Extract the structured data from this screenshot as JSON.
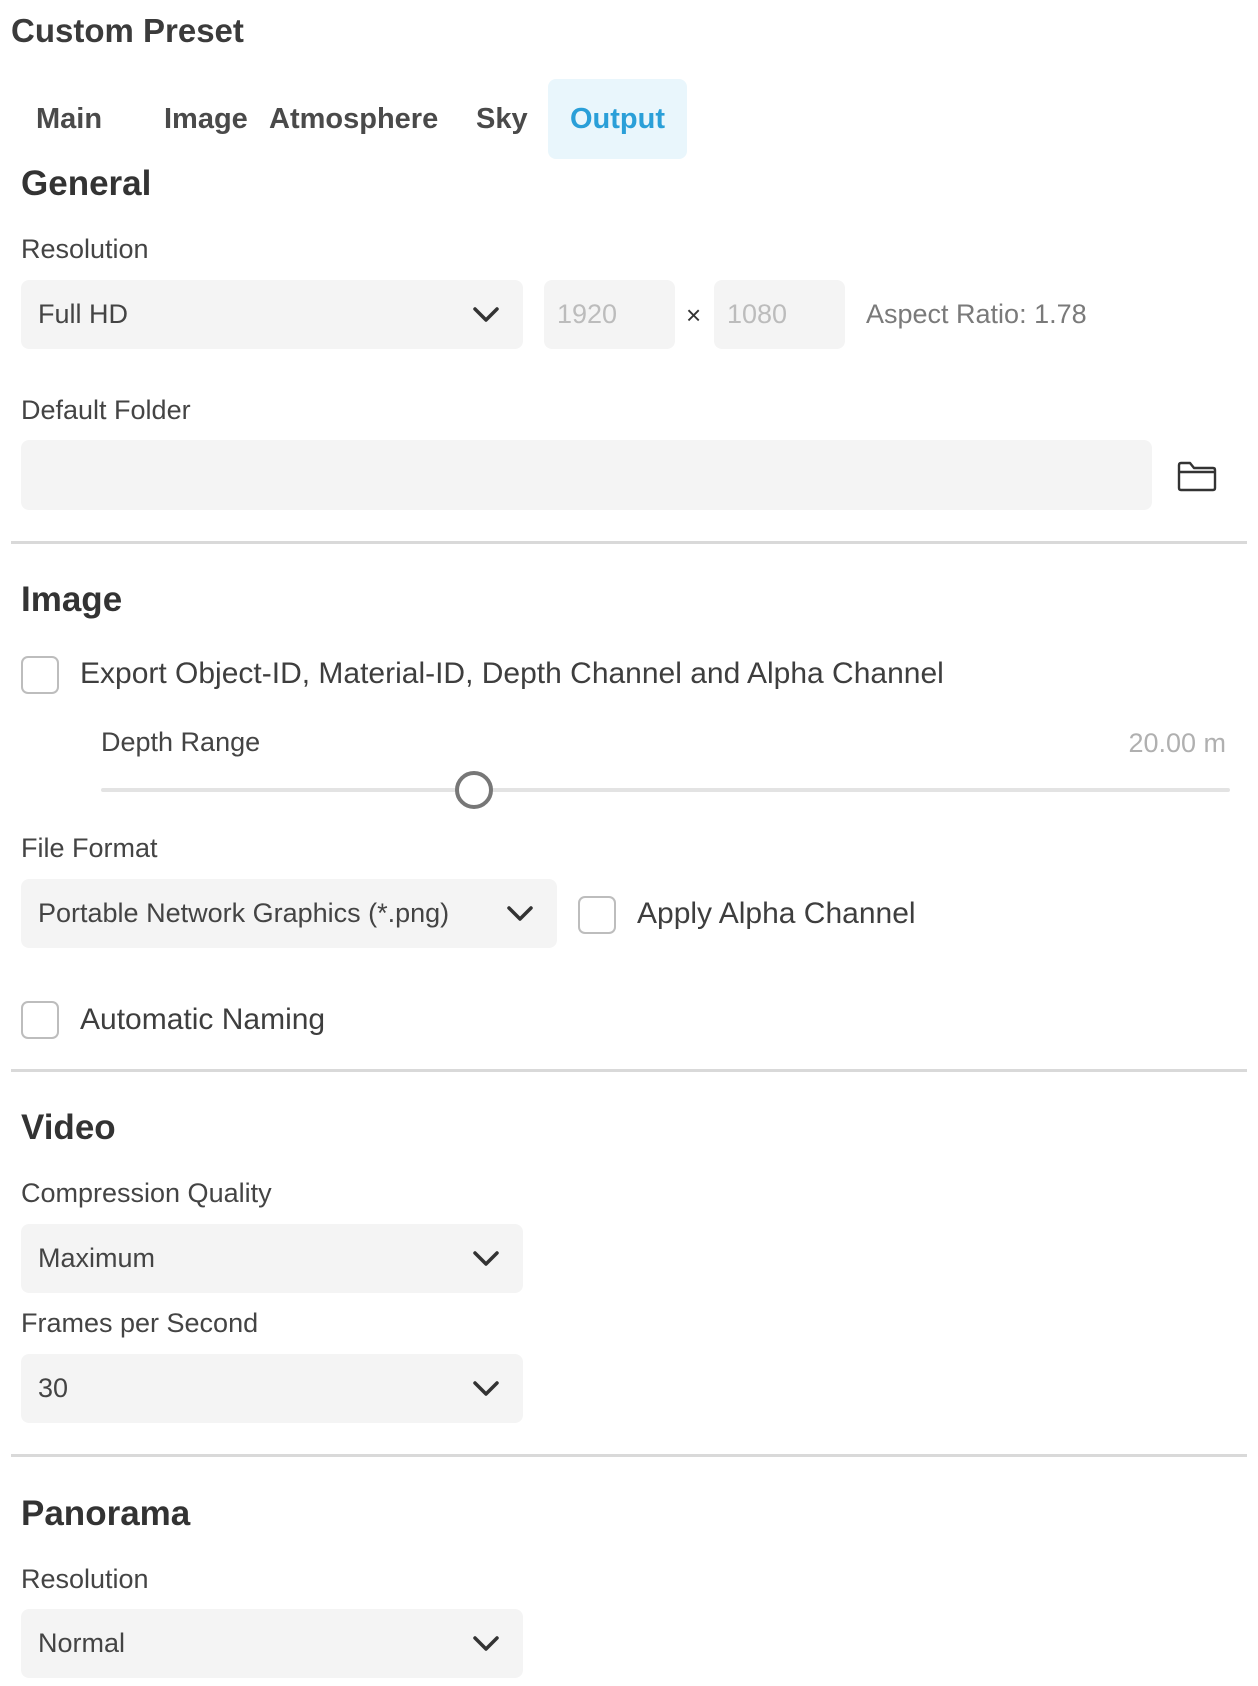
{
  "title": "Custom Preset",
  "tabs": [
    {
      "label": "Main"
    },
    {
      "label": "Image"
    },
    {
      "label": "Atmosphere"
    },
    {
      "label": "Sky"
    },
    {
      "label": "Output",
      "active": true
    }
  ],
  "general": {
    "heading": "General",
    "resolution_label": "Resolution",
    "resolution_value": "Full HD",
    "width": "1920",
    "times": "×",
    "height": "1080",
    "aspect_ratio": "Aspect Ratio: 1.78",
    "default_folder_label": "Default Folder",
    "default_folder_value": ""
  },
  "image": {
    "heading": "Image",
    "export_label": "Export Object-ID, Material-ID, Depth Channel and Alpha Channel",
    "export_checked": false,
    "depth_range_label": "Depth Range",
    "depth_range_value": "20.00 m",
    "depth_range_slider_fraction": 0.33,
    "file_format_label": "File Format",
    "file_format_value": "Portable Network Graphics (*.png)",
    "apply_alpha_label": "Apply Alpha Channel",
    "apply_alpha_checked": false,
    "automatic_naming_label": "Automatic Naming",
    "automatic_naming_checked": false
  },
  "video": {
    "heading": "Video",
    "compression_label": "Compression Quality",
    "compression_value": "Maximum",
    "fps_label": "Frames per Second",
    "fps_value": "30"
  },
  "panorama": {
    "heading": "Panorama",
    "resolution_label": "Resolution",
    "resolution_value": "Normal"
  },
  "colors": {
    "accent": "#2a9fd8",
    "active_tab_bg": "#e9f6fc",
    "field_bg": "#f4f4f4"
  },
  "icons": {
    "chevron": "chevron-down-icon",
    "folder": "folder-icon"
  }
}
